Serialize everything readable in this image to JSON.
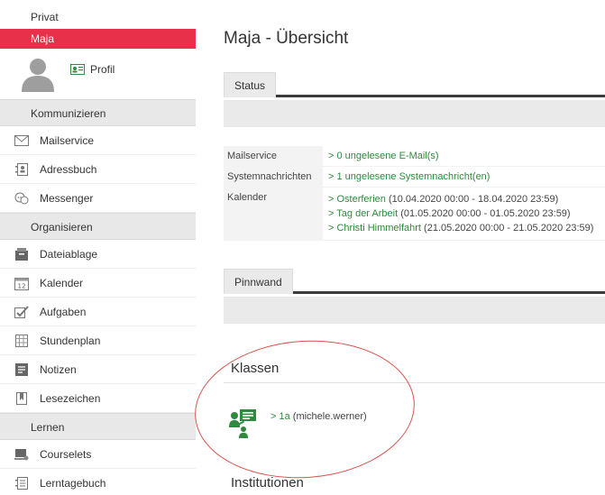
{
  "sidebar": {
    "section_private": "Privat",
    "active_user": "Maja",
    "profile_label": "Profil",
    "groups": [
      {
        "title": "Kommunizieren",
        "items": [
          {
            "label": "Mailservice",
            "icon": "mail-icon"
          },
          {
            "label": "Adressbuch",
            "icon": "address-book-icon"
          },
          {
            "label": "Messenger",
            "icon": "messenger-icon"
          }
        ]
      },
      {
        "title": "Organisieren",
        "items": [
          {
            "label": "Dateiablage",
            "icon": "folder-icon"
          },
          {
            "label": "Kalender",
            "icon": "calendar-icon"
          },
          {
            "label": "Aufgaben",
            "icon": "checkbox-icon"
          },
          {
            "label": "Stundenplan",
            "icon": "timetable-icon"
          },
          {
            "label": "Notizen",
            "icon": "notes-icon"
          },
          {
            "label": "Lesezeichen",
            "icon": "bookmark-icon"
          }
        ]
      },
      {
        "title": "Lernen",
        "items": [
          {
            "label": "Courselets",
            "icon": "courselets-icon"
          },
          {
            "label": "Lerntagebuch",
            "icon": "journal-icon"
          }
        ]
      }
    ]
  },
  "main": {
    "title": "Maja - Übersicht",
    "status_tab": "Status",
    "rows": {
      "mail": {
        "label": "Mailservice",
        "value": "> 0 ungelesene E-Mail(s)"
      },
      "system": {
        "label": "Systemnachrichten",
        "value": "> 1 ungelesene Systemnachricht(en)"
      },
      "calendar": {
        "label": "Kalender",
        "entries": [
          {
            "link": "> Osterferien",
            "dates": " (10.04.2020 00:00 - 18.04.2020 23:59)"
          },
          {
            "link": "> Tag der Arbeit",
            "dates": " (01.05.2020 00:00 - 01.05.2020 23:59)"
          },
          {
            "link": "> Christi Himmelfahrt",
            "dates": " (21.05.2020 00:00 - 21.05.2020 23:59)"
          }
        ]
      }
    },
    "pinnwand_tab": "Pinnwand",
    "classes_title": "Klassen",
    "class_entry": {
      "link": "> 1a",
      "owner": " (michele.werner)"
    },
    "institutions_title": "Institutionen"
  },
  "colors": {
    "active": "#e8304a",
    "link": "#2f8a3e",
    "tab_rule": "#3b3b3b",
    "annotation": "#d9534f"
  }
}
